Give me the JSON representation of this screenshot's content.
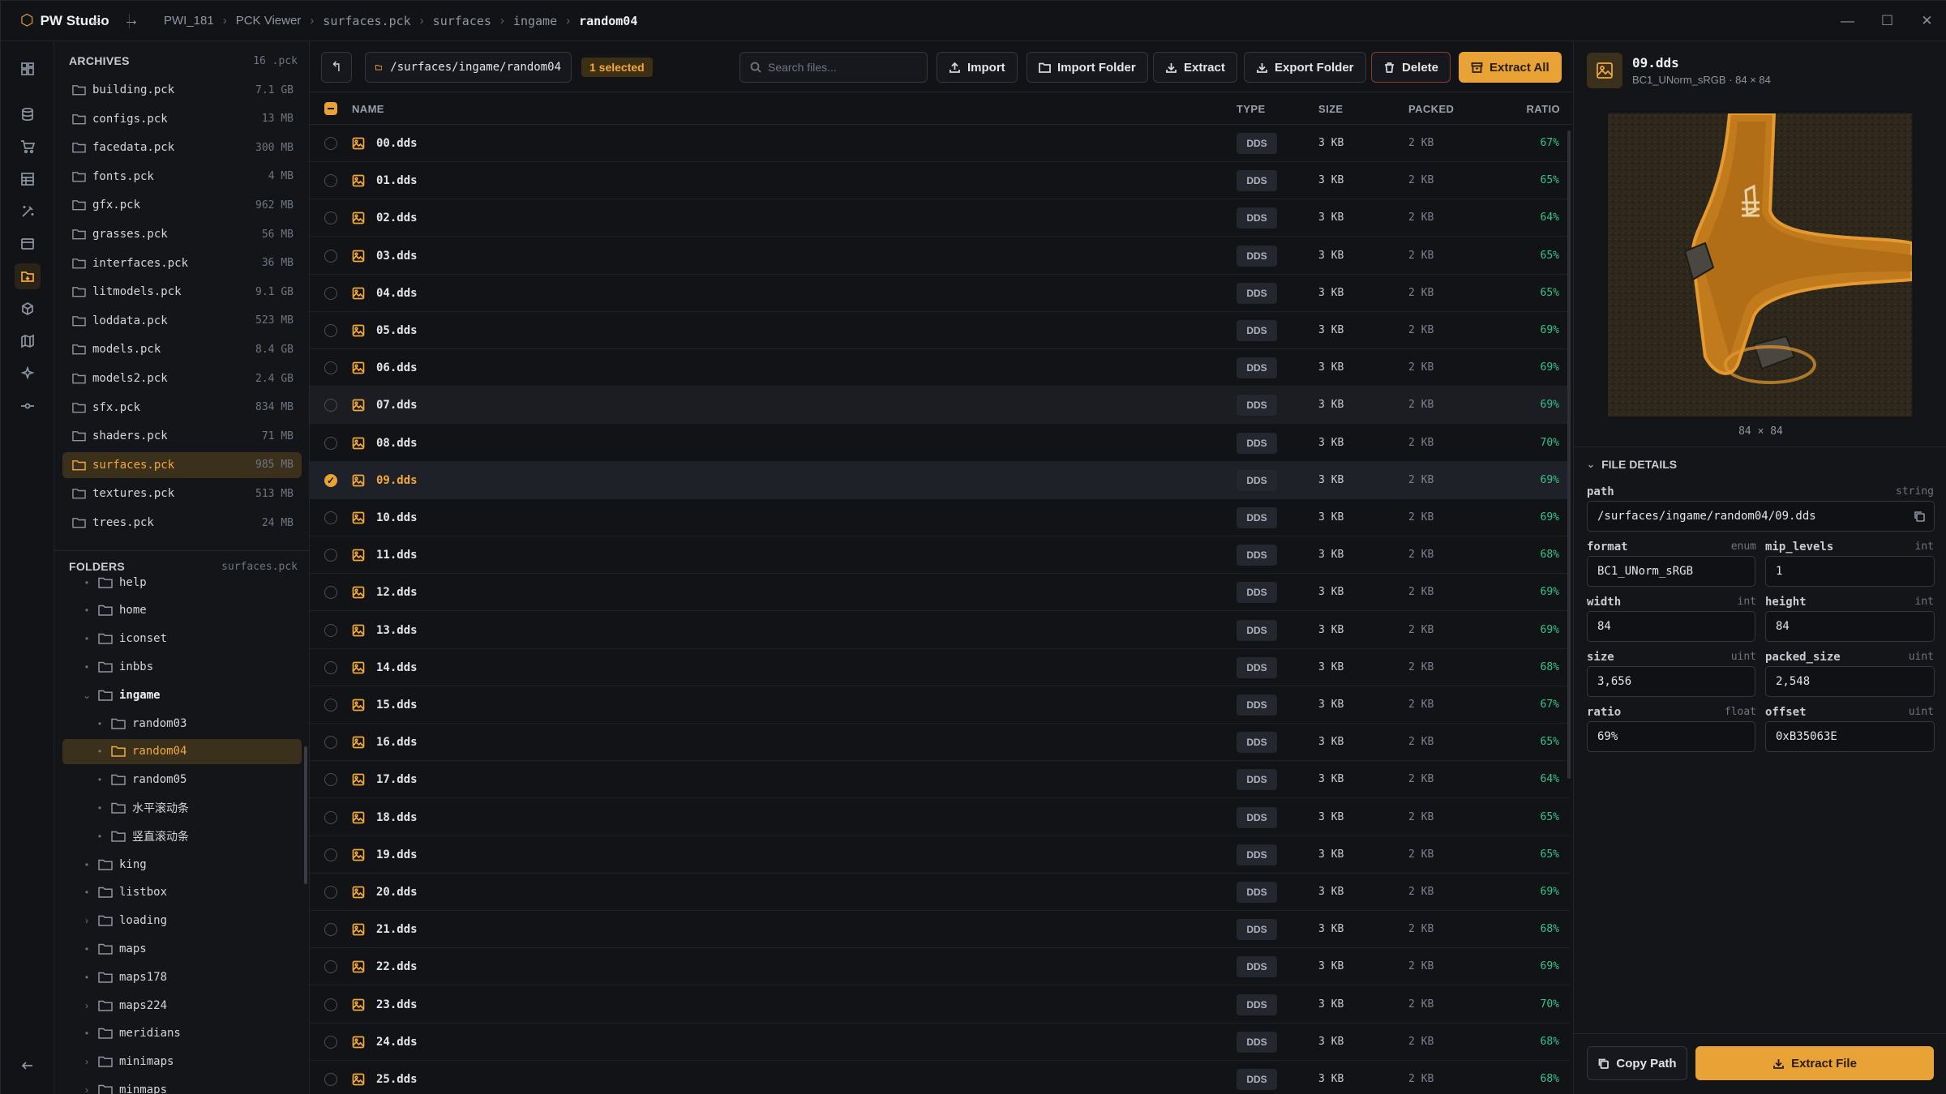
{
  "app": {
    "name": "PW Studio"
  },
  "breadcrumb": [
    "PWI_181",
    "PCK Viewer",
    "surfaces.pck",
    "surfaces",
    "ingame",
    "random04"
  ],
  "archives": {
    "title": "ARCHIVES",
    "count": "16 .pck",
    "items": [
      {
        "name": "building.pck",
        "size": "7.1 GB"
      },
      {
        "name": "configs.pck",
        "size": "13 MB"
      },
      {
        "name": "facedata.pck",
        "size": "300 MB"
      },
      {
        "name": "fonts.pck",
        "size": "4 MB"
      },
      {
        "name": "gfx.pck",
        "size": "962 MB"
      },
      {
        "name": "grasses.pck",
        "size": "56 MB"
      },
      {
        "name": "interfaces.pck",
        "size": "36 MB"
      },
      {
        "name": "litmodels.pck",
        "size": "9.1 GB"
      },
      {
        "name": "loddata.pck",
        "size": "523 MB"
      },
      {
        "name": "models.pck",
        "size": "8.4 GB"
      },
      {
        "name": "models2.pck",
        "size": "2.4 GB"
      },
      {
        "name": "sfx.pck",
        "size": "834 MB"
      },
      {
        "name": "shaders.pck",
        "size": "71 MB"
      },
      {
        "name": "surfaces.pck",
        "size": "985 MB",
        "selected": true
      },
      {
        "name": "textures.pck",
        "size": "513 MB"
      },
      {
        "name": "trees.pck",
        "size": "24 MB"
      }
    ]
  },
  "folders": {
    "title": "FOLDERS",
    "context": "surfaces.pck",
    "items": [
      {
        "name": "help",
        "level": 1,
        "expander": "•"
      },
      {
        "name": "home",
        "level": 1,
        "expander": "•"
      },
      {
        "name": "iconset",
        "level": 1,
        "expander": "•"
      },
      {
        "name": "inbbs",
        "level": 1,
        "expander": "•"
      },
      {
        "name": "ingame",
        "level": 1,
        "expander": "⌄",
        "open": true
      },
      {
        "name": "random03",
        "level": 2,
        "expander": "•"
      },
      {
        "name": "random04",
        "level": 2,
        "expander": "•",
        "selected": true
      },
      {
        "name": "random05",
        "level": 2,
        "expander": "•"
      },
      {
        "name": "水平滚动条",
        "level": 2,
        "expander": "•"
      },
      {
        "name": "竖直滚动条",
        "level": 2,
        "expander": "•"
      },
      {
        "name": "king",
        "level": 1,
        "expander": "•"
      },
      {
        "name": "listbox",
        "level": 1,
        "expander": "•"
      },
      {
        "name": "loading",
        "level": 1,
        "expander": "›"
      },
      {
        "name": "maps",
        "level": 1,
        "expander": "•"
      },
      {
        "name": "maps178",
        "level": 1,
        "expander": "•"
      },
      {
        "name": "maps224",
        "level": 1,
        "expander": "›"
      },
      {
        "name": "meridians",
        "level": 1,
        "expander": "•"
      },
      {
        "name": "minimaps",
        "level": 1,
        "expander": "›"
      },
      {
        "name": "minmaps",
        "level": 1,
        "expander": "›"
      }
    ]
  },
  "toolbar": {
    "path": "/surfaces/ingame/random04",
    "selected_badge": "1 selected",
    "search_placeholder": "Search files...",
    "import": "Import",
    "import_folder": "Import Folder",
    "extract": "Extract",
    "export_folder": "Export Folder",
    "delete": "Delete",
    "extract_all": "Extract All"
  },
  "table": {
    "columns": {
      "name": "NAME",
      "type": "TYPE",
      "size": "SIZE",
      "packed": "PACKED",
      "ratio": "RATIO"
    },
    "rows": [
      {
        "name": "00.dds",
        "type": "DDS",
        "size": "3 KB",
        "packed": "2 KB",
        "ratio": "67%"
      },
      {
        "name": "01.dds",
        "type": "DDS",
        "size": "3 KB",
        "packed": "2 KB",
        "ratio": "65%"
      },
      {
        "name": "02.dds",
        "type": "DDS",
        "size": "3 KB",
        "packed": "2 KB",
        "ratio": "64%"
      },
      {
        "name": "03.dds",
        "type": "DDS",
        "size": "3 KB",
        "packed": "2 KB",
        "ratio": "65%"
      },
      {
        "name": "04.dds",
        "type": "DDS",
        "size": "3 KB",
        "packed": "2 KB",
        "ratio": "65%"
      },
      {
        "name": "05.dds",
        "type": "DDS",
        "size": "3 KB",
        "packed": "2 KB",
        "ratio": "69%"
      },
      {
        "name": "06.dds",
        "type": "DDS",
        "size": "3 KB",
        "packed": "2 KB",
        "ratio": "69%"
      },
      {
        "name": "07.dds",
        "type": "DDS",
        "size": "3 KB",
        "packed": "2 KB",
        "ratio": "69%",
        "hover": true
      },
      {
        "name": "08.dds",
        "type": "DDS",
        "size": "3 KB",
        "packed": "2 KB",
        "ratio": "70%"
      },
      {
        "name": "09.dds",
        "type": "DDS",
        "size": "3 KB",
        "packed": "2 KB",
        "ratio": "69%",
        "selected": true
      },
      {
        "name": "10.dds",
        "type": "DDS",
        "size": "3 KB",
        "packed": "2 KB",
        "ratio": "69%"
      },
      {
        "name": "11.dds",
        "type": "DDS",
        "size": "3 KB",
        "packed": "2 KB",
        "ratio": "68%"
      },
      {
        "name": "12.dds",
        "type": "DDS",
        "size": "3 KB",
        "packed": "2 KB",
        "ratio": "69%"
      },
      {
        "name": "13.dds",
        "type": "DDS",
        "size": "3 KB",
        "packed": "2 KB",
        "ratio": "69%"
      },
      {
        "name": "14.dds",
        "type": "DDS",
        "size": "3 KB",
        "packed": "2 KB",
        "ratio": "68%"
      },
      {
        "name": "15.dds",
        "type": "DDS",
        "size": "3 KB",
        "packed": "2 KB",
        "ratio": "67%"
      },
      {
        "name": "16.dds",
        "type": "DDS",
        "size": "3 KB",
        "packed": "2 KB",
        "ratio": "65%"
      },
      {
        "name": "17.dds",
        "type": "DDS",
        "size": "3 KB",
        "packed": "2 KB",
        "ratio": "64%"
      },
      {
        "name": "18.dds",
        "type": "DDS",
        "size": "3 KB",
        "packed": "2 KB",
        "ratio": "65%"
      },
      {
        "name": "19.dds",
        "type": "DDS",
        "size": "3 KB",
        "packed": "2 KB",
        "ratio": "65%"
      },
      {
        "name": "20.dds",
        "type": "DDS",
        "size": "3 KB",
        "packed": "2 KB",
        "ratio": "69%"
      },
      {
        "name": "21.dds",
        "type": "DDS",
        "size": "3 KB",
        "packed": "2 KB",
        "ratio": "68%"
      },
      {
        "name": "22.dds",
        "type": "DDS",
        "size": "3 KB",
        "packed": "2 KB",
        "ratio": "69%"
      },
      {
        "name": "23.dds",
        "type": "DDS",
        "size": "3 KB",
        "packed": "2 KB",
        "ratio": "70%"
      },
      {
        "name": "24.dds",
        "type": "DDS",
        "size": "3 KB",
        "packed": "2 KB",
        "ratio": "68%"
      },
      {
        "name": "25.dds",
        "type": "DDS",
        "size": "3 KB",
        "packed": "2 KB",
        "ratio": "68%"
      }
    ]
  },
  "preview": {
    "name": "09.dds",
    "subtitle": "BC1_UNorm_sRGB · 84 × 84",
    "dims": "84 × 84"
  },
  "details": {
    "title": "FILE DETAILS",
    "path": {
      "label": "path",
      "type": "string",
      "value": "/surfaces/ingame/random04/09.dds"
    },
    "format": {
      "label": "format",
      "type": "enum",
      "value": "BC1_UNorm_sRGB"
    },
    "mip_levels": {
      "label": "mip_levels",
      "type": "int",
      "value": "1"
    },
    "width": {
      "label": "width",
      "type": "int",
      "value": "84"
    },
    "height": {
      "label": "height",
      "type": "int",
      "value": "84"
    },
    "size": {
      "label": "size",
      "type": "uint",
      "value": "3,656"
    },
    "packed_size": {
      "label": "packed_size",
      "type": "uint",
      "value": "2,548"
    },
    "ratio": {
      "label": "ratio",
      "type": "float",
      "value": "69%"
    },
    "offset": {
      "label": "offset",
      "type": "uint",
      "value": "0xB35063E"
    }
  },
  "actions": {
    "copy_path": "Copy Path",
    "extract_file": "Extract File"
  },
  "colors": {
    "accent": "#e9a235",
    "ratio_green": "#36c48a",
    "danger": "#8a3b34"
  }
}
